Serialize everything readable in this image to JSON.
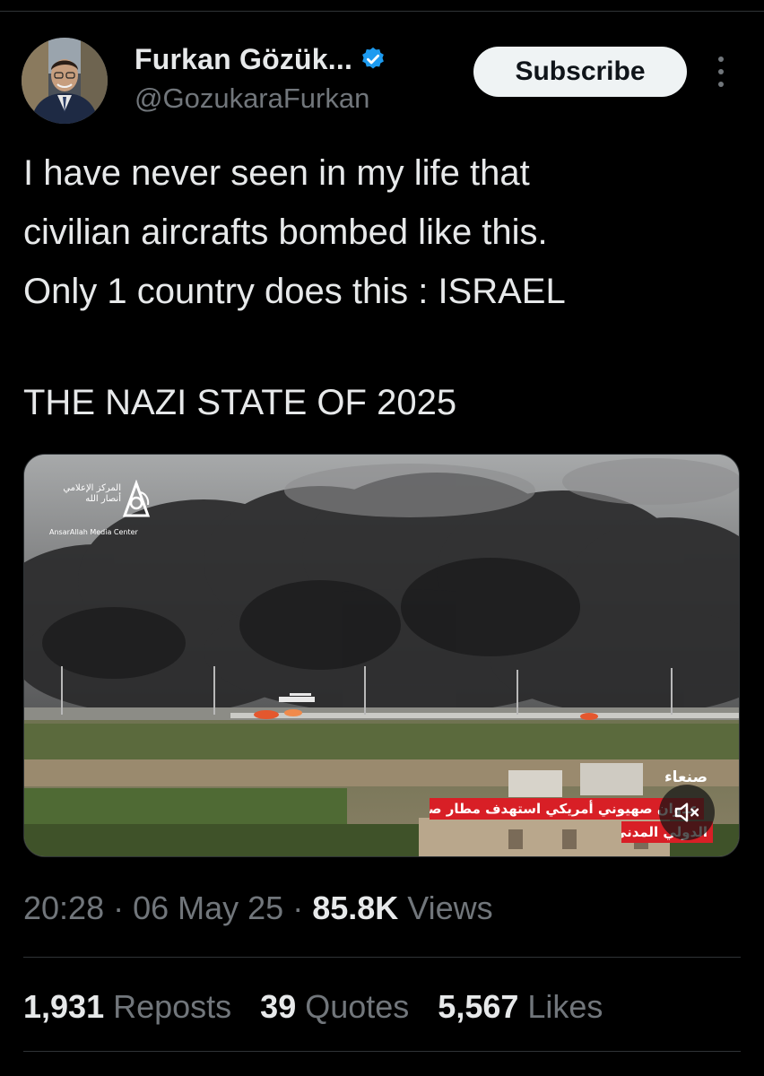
{
  "author": {
    "display_name": "Furkan Gözük...",
    "handle": "@GozukaraFurkan",
    "verified": true
  },
  "header": {
    "subscribe_label": "Subscribe"
  },
  "tweet": {
    "lines": [
      "I have never seen in my life that",
      "civilian aircrafts bombed like this.",
      "Only 1 country does this : ISRAEL",
      "THE NAZI STATE OF 2025"
    ]
  },
  "media": {
    "logo_ar": "المركز الإعلامي أنصار الله",
    "logo_en": "AnsarAllah Media Center",
    "ticker_tag": "صنعاء",
    "ticker_line1": "عدوان صهيوني أمريكي استهدف مطار صنعاء",
    "ticker_line2": "الدولي المدني"
  },
  "meta": {
    "time": "20:28",
    "date": "06 May 25",
    "views_count": "85.8K",
    "views_label": "Views"
  },
  "stats": {
    "reposts_count": "1,931",
    "reposts_label": "Reposts",
    "quotes_count": "39",
    "quotes_label": "Quotes",
    "likes_count": "5,567",
    "likes_label": "Likes"
  },
  "colors": {
    "background": "#000000",
    "text": "#e7e9ea",
    "secondary": "#71767b",
    "verified": "#1d9bf0",
    "ticker": "#d81f26"
  }
}
